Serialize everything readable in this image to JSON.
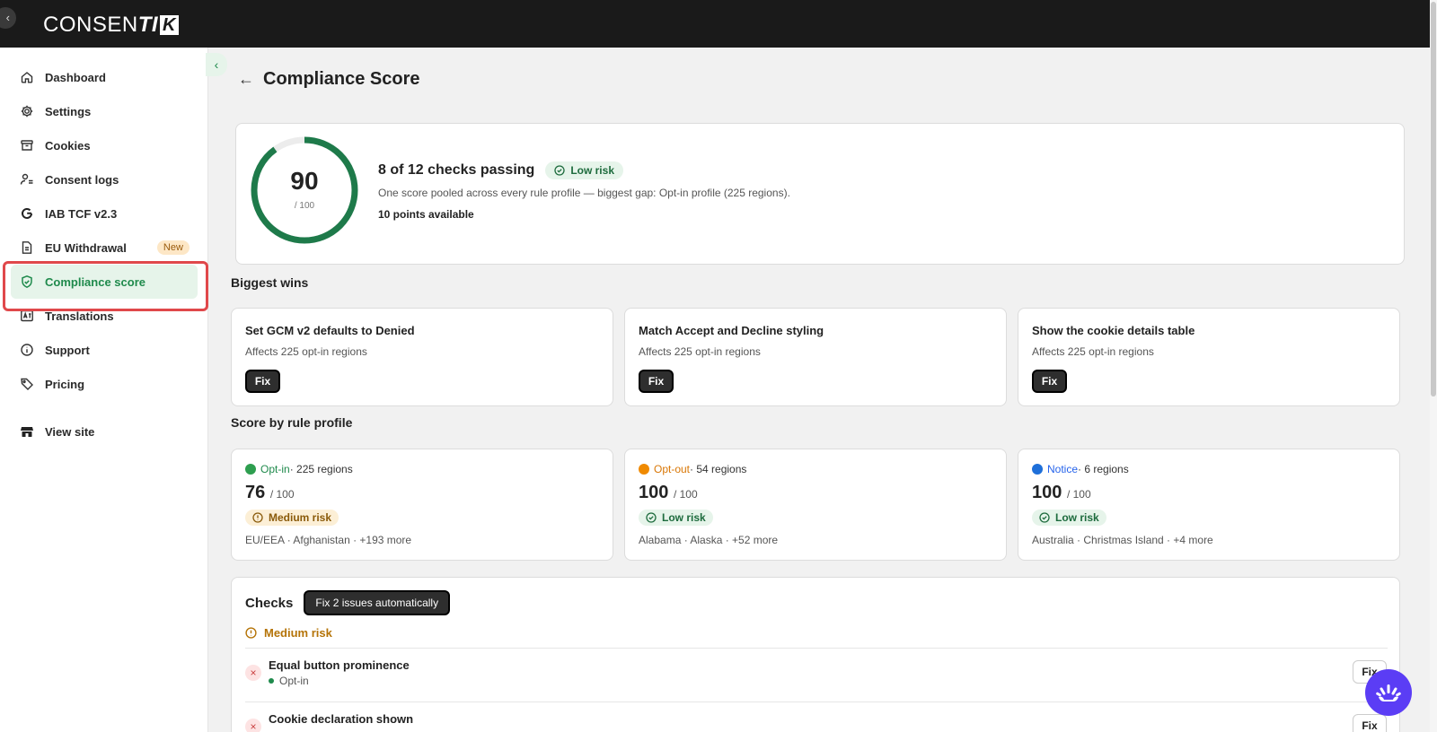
{
  "app": {
    "logo_light": "CONSEN",
    "logo_bold": "TI",
    "logo_box": "K"
  },
  "sidebar": {
    "items": [
      {
        "label": "Dashboard",
        "icon": "home-icon"
      },
      {
        "label": "Settings",
        "icon": "gear-icon"
      },
      {
        "label": "Cookies",
        "icon": "archive-icon"
      },
      {
        "label": "Consent logs",
        "icon": "user-list-icon"
      },
      {
        "label": "IAB TCF v2.3",
        "icon": "google-icon"
      },
      {
        "label": "EU Withdrawal",
        "icon": "document-icon",
        "badge": "New"
      },
      {
        "label": "Compliance score",
        "icon": "shield-check-icon",
        "active": true
      },
      {
        "label": "Translations",
        "icon": "translate-icon"
      },
      {
        "label": "Support",
        "icon": "info-icon"
      },
      {
        "label": "Pricing",
        "icon": "tag-icon"
      }
    ],
    "view_site": {
      "label": "View site",
      "icon": "store-icon"
    }
  },
  "page": {
    "title": "Compliance Score"
  },
  "score": {
    "value": "90",
    "max": "/ 100",
    "fraction": 0.9,
    "title": "8 of 12 checks passing",
    "risk": "Low risk",
    "description": "One score pooled across every rule profile — biggest gap: Opt-in profile (225 regions).",
    "points": "10 points available"
  },
  "biggest_wins": {
    "title": "Biggest wins",
    "items": [
      {
        "title": "Set GCM v2 defaults to Denied",
        "subtitle": "Affects 225 opt-in regions",
        "button": "Fix"
      },
      {
        "title": "Match Accept and Decline styling",
        "subtitle": "Affects 225 opt-in regions",
        "button": "Fix"
      },
      {
        "title": "Show the cookie details table",
        "subtitle": "Affects 225 opt-in regions",
        "button": "Fix"
      }
    ]
  },
  "profiles": {
    "title": "Score by rule profile",
    "items": [
      {
        "name": "Opt-in",
        "regions": " · 225 regions",
        "score": "76",
        "max": "/ 100",
        "risk": "Medium risk",
        "risk_level": "medium",
        "color": "#2e9e4f",
        "name_color": "#1f8a4c",
        "region_list": "EU/EEA · Afghanistan · +193 more"
      },
      {
        "name": "Opt-out",
        "regions": " · 54 regions",
        "score": "100",
        "max": "/ 100",
        "risk": "Low risk",
        "risk_level": "low",
        "color": "#f08a00",
        "name_color": "#d97706",
        "region_list": "Alabama · Alaska · +52 more"
      },
      {
        "name": "Notice",
        "regions": " · 6 regions",
        "score": "100",
        "max": "/ 100",
        "risk": "Low risk",
        "risk_level": "low",
        "color": "#1e6fd9",
        "name_color": "#2563eb",
        "region_list": "Australia · Christmas Island · +4 more"
      }
    ]
  },
  "checks": {
    "title": "Checks",
    "auto_fix": "Fix 2 issues automatically",
    "group": "Medium risk",
    "rows": [
      {
        "name": "Equal button prominence",
        "profile": "Opt-in",
        "button": "Fix"
      },
      {
        "name": "Cookie declaration shown",
        "profile": "",
        "button": "Fix"
      }
    ]
  },
  "colors": {
    "accent": "#1f8a4c",
    "ring": "#1e7a4a",
    "topbar": "#1a1a1a",
    "highlight": "#e0484b",
    "chat": "#5b3df5"
  }
}
